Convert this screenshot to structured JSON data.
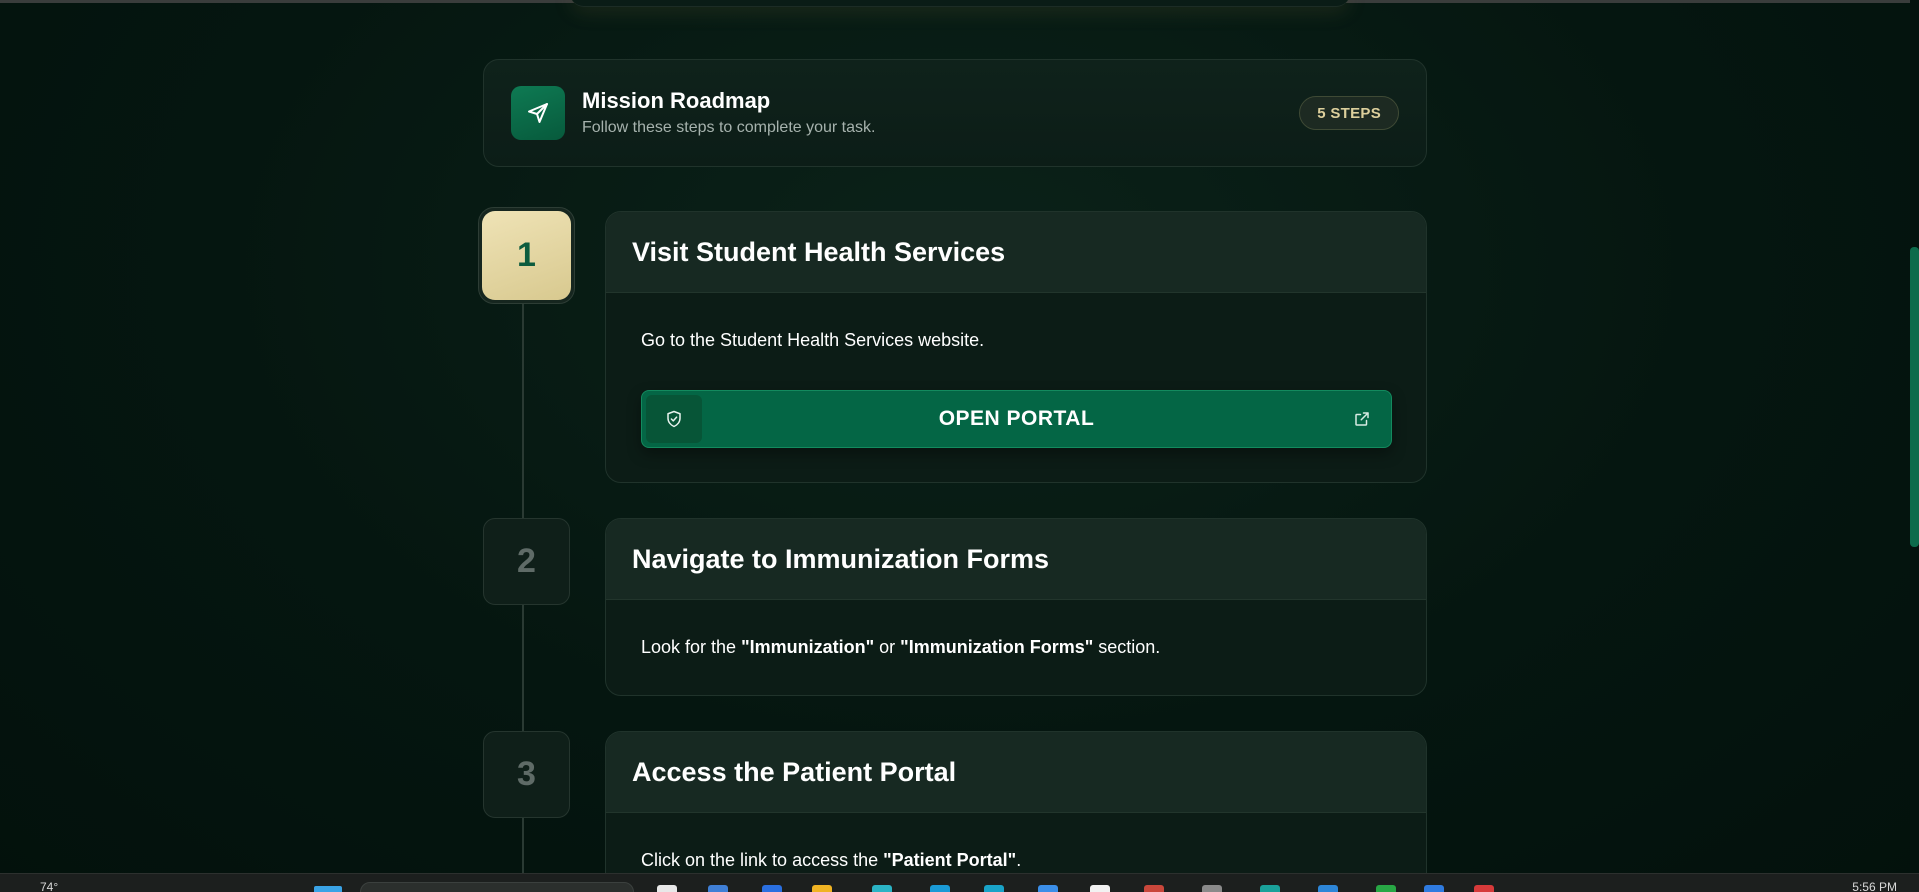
{
  "header": {
    "title": "Mission Roadmap",
    "subtitle": "Follow these steps to complete your task.",
    "icon": "send-icon",
    "badge": "5 STEPS"
  },
  "steps": [
    {
      "number": "1",
      "title": "Visit Student Health Services",
      "description": "Go to the Student Health Services website.",
      "button_label": "OPEN PORTAL",
      "button_icons": [
        "shield-check-icon",
        "external-link-icon"
      ]
    },
    {
      "number": "2",
      "title": "Navigate to Immunization Forms",
      "desc_prefix": "Look for the ",
      "desc_bold1": "\"Immunization\"",
      "desc_mid": " or ",
      "desc_bold2": "\"Immunization Forms\"",
      "desc_suffix": " section."
    },
    {
      "number": "3",
      "title": "Access the Patient Portal",
      "desc_prefix": "Click on the link to access the ",
      "desc_bold1": "\"Patient Portal\"",
      "desc_suffix": "."
    }
  ],
  "taskbar": {
    "weather": "74°",
    "clock": "5:56 PM"
  },
  "colors": {
    "accent_green": "#046645",
    "active_step_bg": "#e4d7a4",
    "badge_text": "#dccf9c",
    "page_bg": "#051610"
  }
}
